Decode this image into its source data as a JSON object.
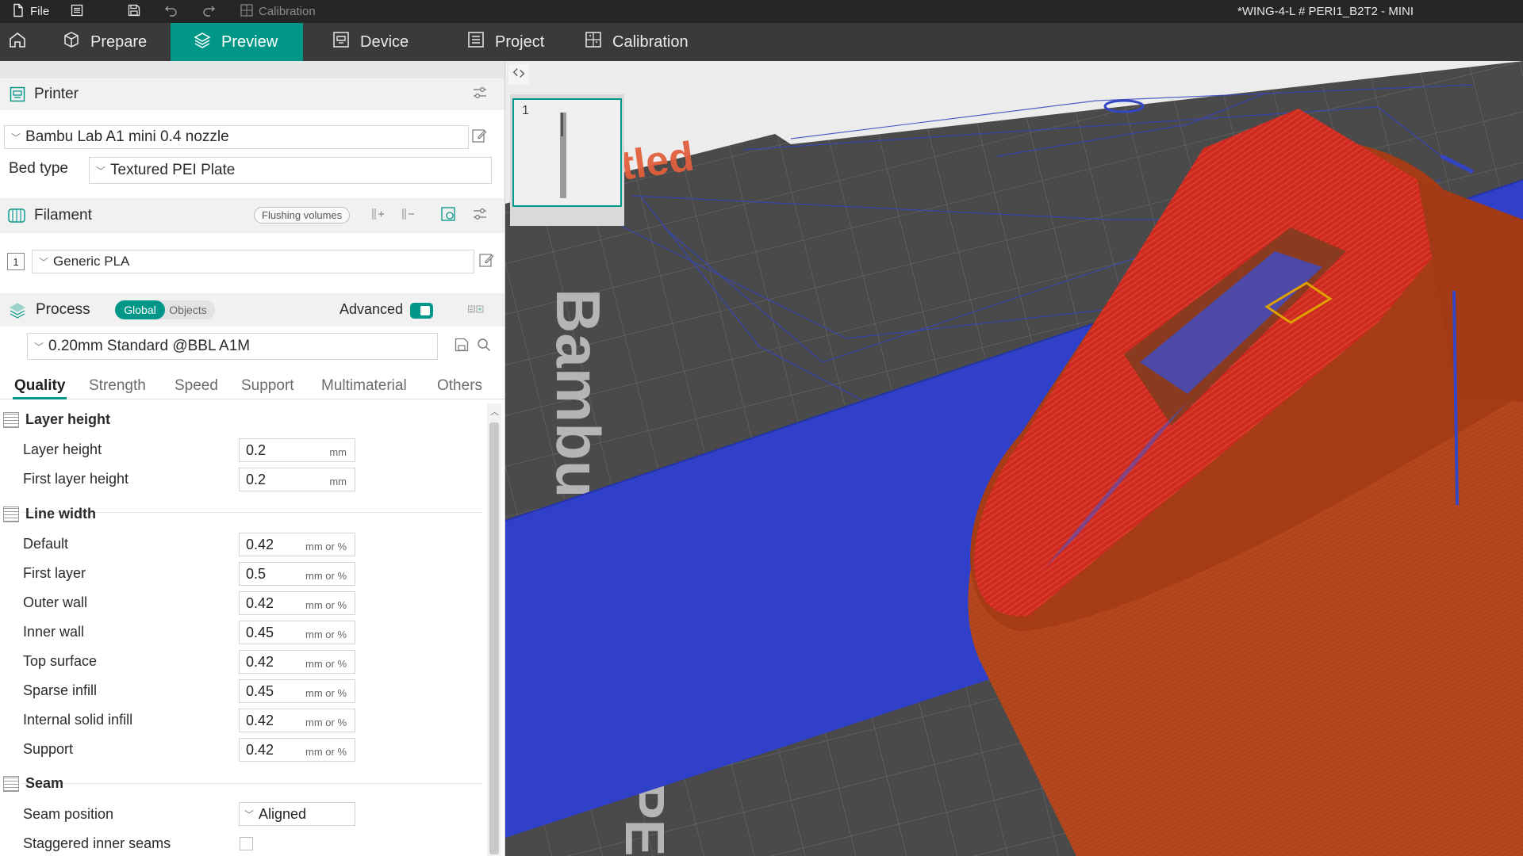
{
  "titlebar": {
    "file_label": "File",
    "calibration_label": "Calibration",
    "window_title": "*WING-4-L # PERI1_B2T2 - MINI"
  },
  "nav": {
    "tabs": [
      {
        "label": "Prepare",
        "icon": "cube-icon"
      },
      {
        "label": "Preview",
        "icon": "layers-icon",
        "active": true
      },
      {
        "label": "Device",
        "icon": "device-icon"
      },
      {
        "label": "Project",
        "icon": "project-icon"
      },
      {
        "label": "Calibration",
        "icon": "calibration-icon"
      }
    ]
  },
  "printer": {
    "section_title": "Printer",
    "preset": "Bambu Lab A1 mini 0.4 nozzle",
    "bed_type_label": "Bed type",
    "bed_type": "Textured PEI Plate"
  },
  "filament": {
    "section_title": "Filament",
    "flushing_label": "Flushing volumes",
    "slot_number": "1",
    "preset": "Generic PLA"
  },
  "process": {
    "section_title": "Process",
    "toggle_global": "Global",
    "toggle_objects": "Objects",
    "advanced_label": "Advanced",
    "advanced_on": true,
    "preset": "0.20mm Standard @BBL A1M",
    "tabs": [
      "Quality",
      "Strength",
      "Speed",
      "Support",
      "Multimaterial",
      "Others"
    ],
    "active_tab": "Quality"
  },
  "quality": {
    "layer_height_group": "Layer height",
    "layer_height_label": "Layer height",
    "layer_height_value": "0.2",
    "layer_height_unit": "mm",
    "first_layer_height_label": "First layer height",
    "first_layer_height_value": "0.2",
    "first_layer_height_unit": "mm",
    "line_width_group": "Line width",
    "line_widths": [
      {
        "label": "Default",
        "value": "0.42",
        "unit": "mm or %"
      },
      {
        "label": "First layer",
        "value": "0.5",
        "unit": "mm or %"
      },
      {
        "label": "Outer wall",
        "value": "0.42",
        "unit": "mm or %"
      },
      {
        "label": "Inner wall",
        "value": "0.45",
        "unit": "mm or %"
      },
      {
        "label": "Top surface",
        "value": "0.42",
        "unit": "mm or %"
      },
      {
        "label": "Sparse infill",
        "value": "0.45",
        "unit": "mm or %"
      },
      {
        "label": "Internal solid infill",
        "value": "0.42",
        "unit": "mm or %"
      },
      {
        "label": "Support",
        "value": "0.42",
        "unit": "mm or %"
      }
    ],
    "seam_group": "Seam",
    "seam_position_label": "Seam position",
    "seam_position_value": "Aligned",
    "staggered_label": "Staggered inner seams",
    "staggered_checked": false
  },
  "viewport": {
    "plate_number": "1",
    "plate_watermark": "Untitled",
    "bed_brand_text": "Bambu",
    "bed_plate_text": "PEI"
  },
  "colors": {
    "accent": "#009688",
    "model_wall": "#b8461a",
    "model_top": "#d4281e",
    "travel_blue": "#2f3ec2"
  }
}
